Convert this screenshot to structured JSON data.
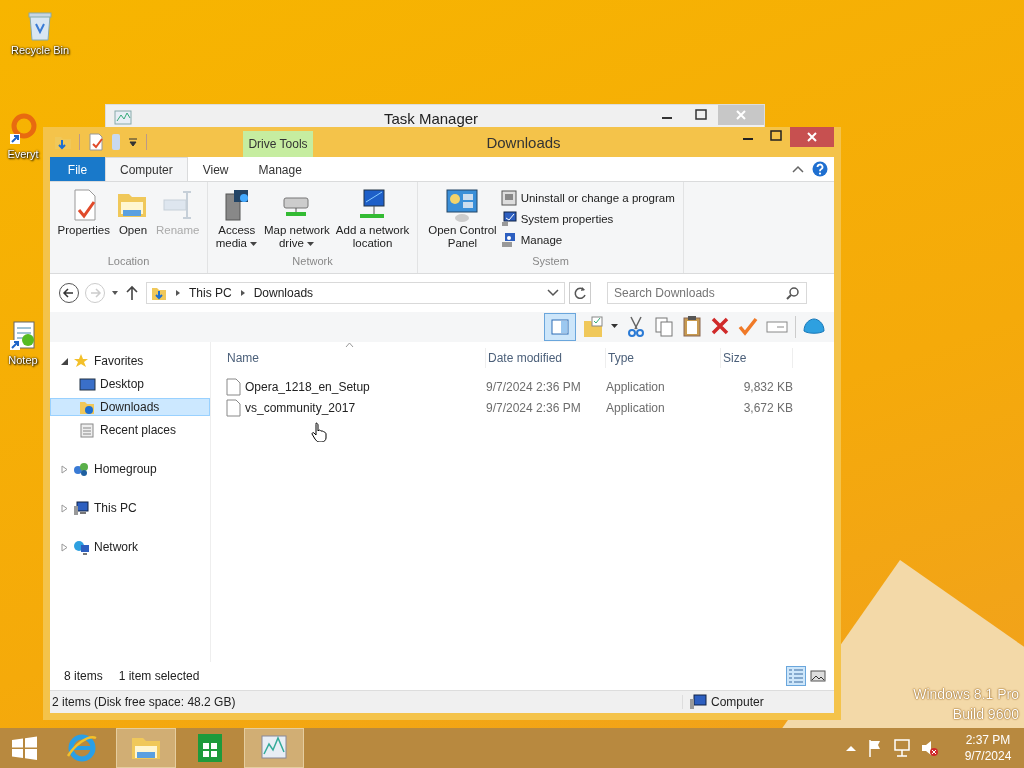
{
  "desktop_icons": [
    {
      "label": "Recycle Bin"
    },
    {
      "label": "Everyt"
    },
    {
      "label": "Notep"
    }
  ],
  "background_window": {
    "title": "Task Manager"
  },
  "window": {
    "title": "Downloads",
    "contextual_group": "Drive Tools"
  },
  "ribbon_tabs": [
    {
      "label": "File",
      "kind": "file",
      "selected": false
    },
    {
      "label": "Computer",
      "kind": "tab",
      "selected": true
    },
    {
      "label": "View",
      "kind": "tab",
      "selected": false
    },
    {
      "label": "Manage",
      "kind": "tab",
      "selected": false
    }
  ],
  "ribbon_groups": [
    {
      "name": "Location",
      "items": [
        {
          "label": "Properties",
          "kind": "large",
          "disabled": false,
          "dropdown": false
        },
        {
          "label": "Open",
          "kind": "large",
          "disabled": false,
          "dropdown": false
        },
        {
          "label": "Rename",
          "kind": "large",
          "disabled": true,
          "dropdown": false
        }
      ]
    },
    {
      "name": "Network",
      "items": [
        {
          "label": "Access\nmedia",
          "kind": "large",
          "disabled": false,
          "dropdown": true
        },
        {
          "label": "Map network\ndrive",
          "kind": "large",
          "disabled": false,
          "dropdown": true
        },
        {
          "label": "Add a network\nlocation",
          "kind": "large",
          "disabled": false,
          "dropdown": false
        }
      ]
    },
    {
      "name": "System",
      "items": [
        {
          "label": "Open Control\nPanel",
          "kind": "large",
          "disabled": false,
          "dropdown": false
        },
        {
          "label": "Uninstall or change a program",
          "kind": "small",
          "disabled": false,
          "dropdown": false
        },
        {
          "label": "System properties",
          "kind": "small",
          "disabled": false,
          "dropdown": false
        },
        {
          "label": "Manage",
          "kind": "small",
          "disabled": false,
          "dropdown": false
        }
      ]
    }
  ],
  "address": {
    "path": [
      "This PC",
      "Downloads"
    ],
    "search_placeholder": "Search Downloads"
  },
  "toolbar": {
    "preview_pane": {
      "selected": true
    }
  },
  "navigation": [
    {
      "label": "Favorites",
      "expanded": true,
      "selected": false,
      "children": [
        {
          "label": "Desktop",
          "selected": false
        },
        {
          "label": "Downloads",
          "selected": true
        },
        {
          "label": "Recent places",
          "selected": false
        }
      ]
    },
    {
      "label": "Homegroup",
      "expanded": false,
      "selected": false
    },
    {
      "label": "This PC",
      "expanded": false,
      "selected": false
    },
    {
      "label": "Network",
      "expanded": false,
      "selected": false
    }
  ],
  "file_list": {
    "columns": [
      "Name",
      "Date modified",
      "Type",
      "Size"
    ],
    "rows": [
      {
        "name": "Opera_1218_en_Setup",
        "date": "9/7/2024 2:36 PM",
        "type": "Application",
        "size": "9,832 KB"
      },
      {
        "name": "vs_community_2017",
        "date": "9/7/2024 2:36 PM",
        "type": "Application",
        "size": "3,672 KB"
      }
    ]
  },
  "status": {
    "items": "8 items",
    "selection": "1 item selected",
    "views": [
      {
        "kind": "details",
        "selected": true
      },
      {
        "kind": "large-icons",
        "selected": false
      }
    ]
  },
  "status_bar": {
    "info": "2 items (Disk free space: 48.2 GB)",
    "zone": "Computer"
  },
  "watermark": {
    "edition": "Windows 8.1 Pro",
    "build": "Build 9600"
  },
  "taskbar": {
    "apps": [
      {
        "kind": "browser",
        "highlighted": false
      },
      {
        "kind": "explorer",
        "highlighted": true
      },
      {
        "kind": "store",
        "highlighted": false
      },
      {
        "kind": "task-manager",
        "highlighted": true
      }
    ],
    "time": "2:37 PM",
    "date": "9/7/2024"
  }
}
